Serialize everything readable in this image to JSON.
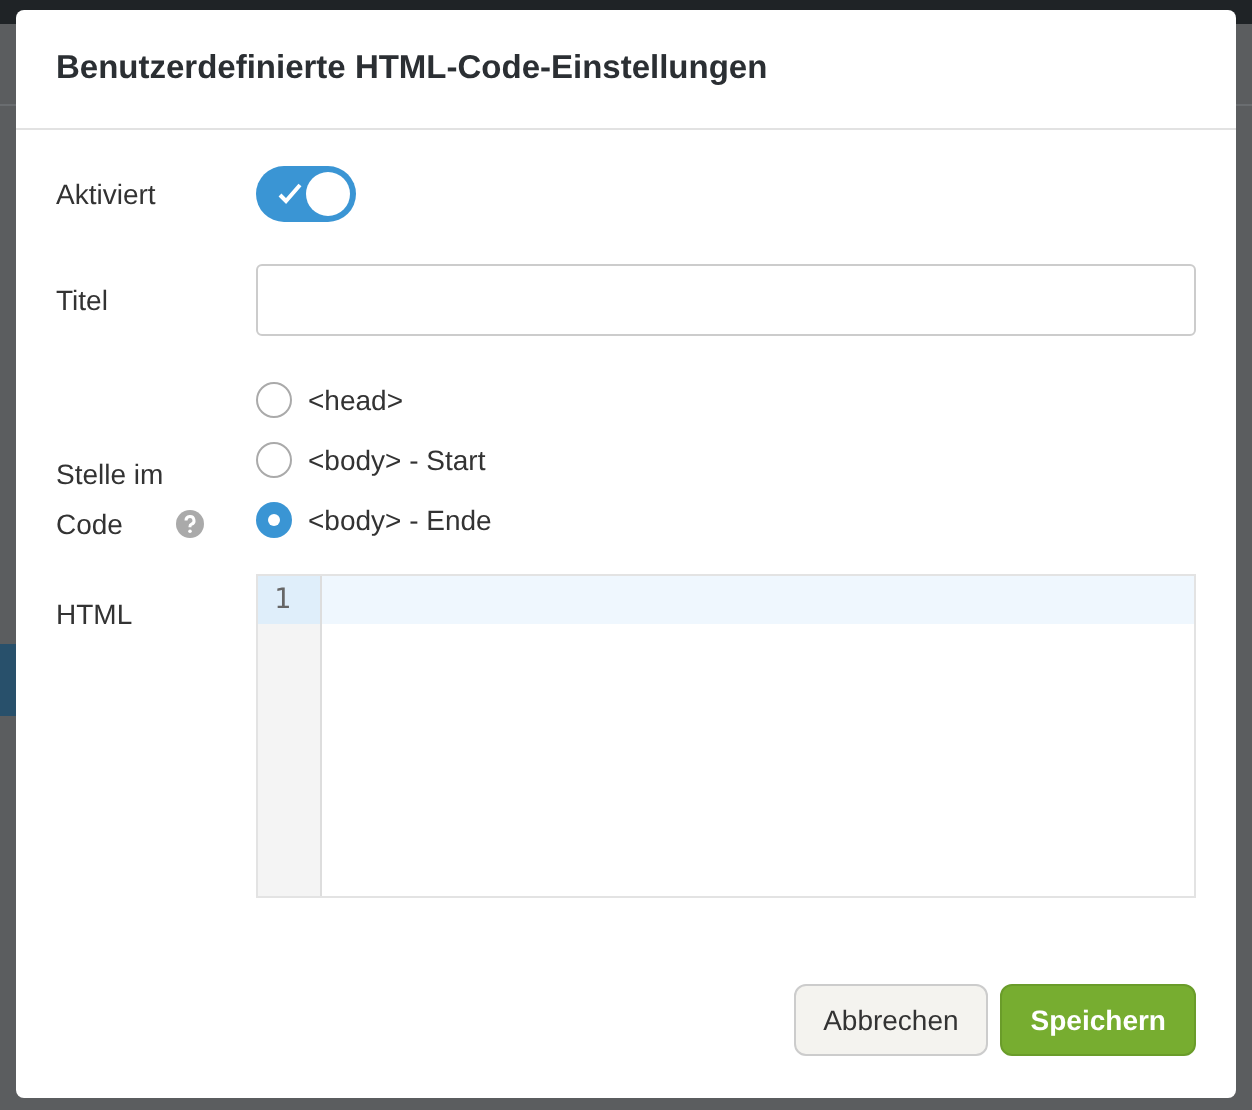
{
  "dialog": {
    "title": "Benutzerdefinierte HTML-Code-Einstellungen",
    "fields": [
      {
        "kind": "toggle",
        "label": "Aktiviert",
        "on": true
      },
      {
        "kind": "text",
        "label": "Titel"
      },
      {
        "kind": "radio",
        "label": "Stelle im Code",
        "help": true,
        "options": [
          {
            "label": "<head>",
            "selected": false
          },
          {
            "label": "<body> - Start",
            "selected": false
          },
          {
            "label": "<body> - Ende",
            "selected": true
          }
        ]
      },
      {
        "kind": "code",
        "label": "HTML",
        "line_numbers": [
          "1"
        ]
      }
    ],
    "buttons": [
      {
        "label": "Abbrechen",
        "kind": "secondary"
      },
      {
        "label": "Speichern",
        "kind": "primary"
      }
    ]
  }
}
